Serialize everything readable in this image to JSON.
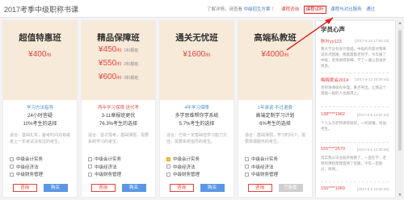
{
  "header": {
    "title": "2017考季中级职称书课",
    "notice_text": "了解详情，请查看",
    "notice_link": "中级招生方案",
    "notice_close": "！",
    "nav": [
      {
        "label": "课程咨询",
        "state": "current"
      },
      {
        "label": "课程试听",
        "state": "boxed"
      },
      {
        "label": "课程与对比服务",
        "state": "link"
      },
      {
        "label": "通过",
        "state": "link"
      }
    ]
  },
  "plans": [
    {
      "name": "超值特惠班",
      "prices": [
        {
          "amount": "¥400",
          "unit": "/科",
          "note": ""
        }
      ],
      "subtitle": "学习方法指导",
      "subtitle_color": "blue",
      "features": [
        "24小时答疑",
        "10%考生的选择"
      ],
      "description": "适合：基础扎实，备考时间充裕或者上一年考试没有过的考生。",
      "subjects": [
        {
          "label": "中级会计实务",
          "checked": false
        },
        {
          "label": "中级经济法",
          "checked": false
        },
        {
          "label": "中级财务管理",
          "checked": false
        }
      ],
      "consult_label": "咨询",
      "buy_label": "购买",
      "buy_state": "active"
    },
    {
      "name": "精品保障班",
      "prices": [
        {
          "amount": "¥450",
          "unit": "/科",
          "note": "1科报班"
        },
        {
          "amount": "¥550",
          "unit": "/科",
          "note": "2科报班"
        },
        {
          "amount": "¥600",
          "unit": "/科",
          "note": "3科报班"
        }
      ],
      "subtitle": "两年学习保障 送代考",
      "subtitle_color": "red",
      "features": [
        "3-11章报班更优",
        "76.3%考生的选择"
      ],
      "description": "适合：首次报考，基础薄弱，需要系统学习的考生。",
      "subjects": [
        {
          "label": "中级会计实务",
          "checked": false
        },
        {
          "label": "中级经济法",
          "checked": false
        },
        {
          "label": "中级财务管理",
          "checked": false
        }
      ],
      "consult_label": "咨询",
      "buy_label": "购买",
      "buy_state": "active"
    },
    {
      "name": "通关无忧班",
      "prices": [
        {
          "amount": "¥1600",
          "unit": "/科",
          "note": ""
        }
      ],
      "subtitle": "4年学习保障",
      "subtitle_color": "blue",
      "features": [
        "多学思维帮你学系统",
        "5.7%考生的选择"
      ],
      "description": "适合：已有一定基础但学习能力欠佳，需要系统指导的考生。",
      "subjects": [
        {
          "label": "中级会计实务",
          "checked": true
        },
        {
          "label": "中级经济法",
          "checked": false
        },
        {
          "label": "中级财务管理",
          "checked": false
        }
      ],
      "consult_label": "咨询",
      "buy_label": "购买",
      "buy_state": "active"
    },
    {
      "name": "高端私教班",
      "prices": [
        {
          "amount": "¥4000",
          "unit": "/科",
          "note": ""
        }
      ],
      "subtitle": "1年承诺 不过退费",
      "subtitle_color": "blue",
      "features": [
        "高端定制学习计划",
        "6%考生的选择"
      ],
      "description": "适合：基础薄弱，学习时间少，需要高端服务的考生。",
      "subjects": [
        {
          "label": "中级会计实务",
          "checked": false
        },
        {
          "label": "中级经济法",
          "checked": false
        },
        {
          "label": "中级财务管理",
          "checked": false
        }
      ],
      "consult_label": "咨询",
      "buy_label": "已售罄",
      "buy_state": "disabled"
    }
  ],
  "sidebar": {
    "title": "学员心声",
    "reviews": [
      {
        "user": "秋叶yy123",
        "date": "[2017-5-24 17:55:13]",
        "text": "我大学没有会计基础，中级的内容对我来说有点困难，想着跟着老师学，今年报了中级，老师讲得很细，学了一遍以后进步很多。"
      },
      {
        "user": "梅梅爱会2014",
        "date": "[2017-6-12 20:29:44]",
        "text": "老师讲课很有条理，重点突出，让我这个基础一般的人也跟得上。"
      },
      {
        "user": "138****1962",
        "date": "[2017-6-9 14:57:24]",
        "text": "个人认为老师讲得很好，一听就懂，往届考生。"
      },
      {
        "user": "155****2570",
        "date": "[2017-6-2 12:30:39]",
        "text": "其实我从毕业就开始看了，一直在学，老师的课程帮我理清了思路，今年一定能过，谢谢。"
      },
      {
        "user": "155****1069",
        "date": "[2017-6-2 11:52:26]",
        "text": ""
      }
    ]
  }
}
